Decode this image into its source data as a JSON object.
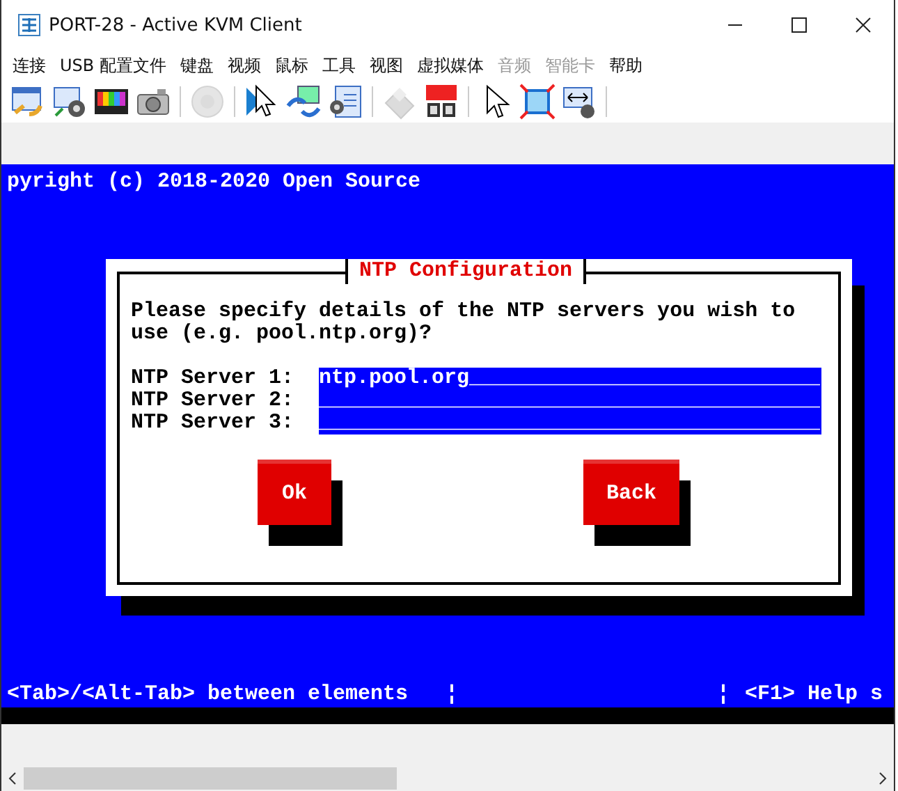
{
  "window": {
    "title": "PORT-28 - Active KVM Client"
  },
  "menu": [
    {
      "label": "连接",
      "disabled": false
    },
    {
      "label": "USB 配置文件",
      "disabled": false
    },
    {
      "label": "键盘",
      "disabled": false
    },
    {
      "label": "视频",
      "disabled": false
    },
    {
      "label": "鼠标",
      "disabled": false
    },
    {
      "label": "工具",
      "disabled": false
    },
    {
      "label": "视图",
      "disabled": false
    },
    {
      "label": "虚拟媒体",
      "disabled": false
    },
    {
      "label": "音频",
      "disabled": true
    },
    {
      "label": "智能卡",
      "disabled": true
    },
    {
      "label": "帮助",
      "disabled": false
    }
  ],
  "toolbar": [
    {
      "kind": "connect",
      "disabled": false
    },
    {
      "kind": "webcam",
      "disabled": false
    },
    {
      "kind": "colorbars",
      "disabled": false
    },
    {
      "kind": "camera",
      "disabled": false
    },
    {
      "kind": "sep"
    },
    {
      "kind": "speaker",
      "disabled": true
    },
    {
      "kind": "sep"
    },
    {
      "kind": "pointer",
      "disabled": false
    },
    {
      "kind": "sync",
      "disabled": false
    },
    {
      "kind": "monitorcam",
      "disabled": false
    },
    {
      "kind": "sep"
    },
    {
      "kind": "usb",
      "disabled": true
    },
    {
      "kind": "ctrlaltdel",
      "disabled": false
    },
    {
      "kind": "sep"
    },
    {
      "kind": "arrow",
      "disabled": false
    },
    {
      "kind": "fullscreen",
      "disabled": false
    },
    {
      "kind": "scale",
      "disabled": false
    },
    {
      "kind": "sep"
    }
  ],
  "console": {
    "lines": [
      "pyright (c) 2018-2020 Open Source"
    ]
  },
  "dialog": {
    "title": "NTP Configuration",
    "message": "Please specify details of the NTP servers you wish to\nuse (e.g. pool.ntp.org)?",
    "fields": [
      {
        "label": "NTP Server 1:",
        "value": "ntp.pool.org____________________________"
      },
      {
        "label": "NTP Server 2:",
        "value": "________________________________________"
      },
      {
        "label": "NTP Server 3:",
        "value": "________________________________________"
      }
    ],
    "buttons": [
      "Ok",
      "Back"
    ]
  },
  "status": [
    "<Tab>/<Alt-Tab> between elements",
    "¦",
    "¦",
    "<F1> Help s"
  ]
}
